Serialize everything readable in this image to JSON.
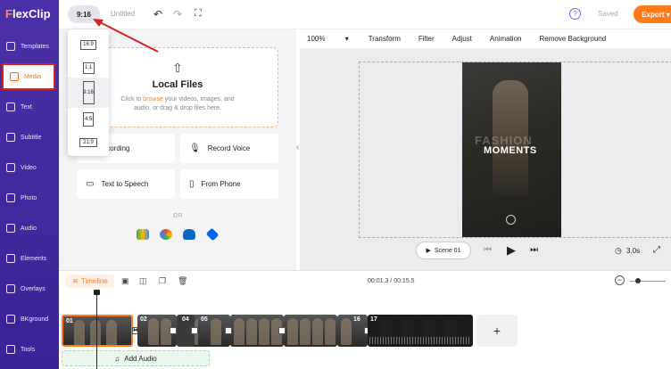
{
  "app": {
    "logo_prefix": "F",
    "logo_rest": "lexClip"
  },
  "sidebar": {
    "items": [
      {
        "label": "Templates",
        "icon": "templates-icon"
      },
      {
        "label": "Media",
        "icon": "media-icon",
        "active": true
      },
      {
        "label": "Text",
        "icon": "text-icon"
      },
      {
        "label": "Subtitle",
        "icon": "subtitle-icon"
      },
      {
        "label": "Video",
        "icon": "video-icon"
      },
      {
        "label": "Photo",
        "icon": "photo-icon"
      },
      {
        "label": "Audio",
        "icon": "audio-icon"
      },
      {
        "label": "Elements",
        "icon": "elements-icon"
      },
      {
        "label": "Overlays",
        "icon": "overlays-icon"
      },
      {
        "label": "BKground",
        "icon": "background-icon"
      },
      {
        "label": "Tools",
        "icon": "tools-icon"
      }
    ]
  },
  "topbar": {
    "ratio": "9:16",
    "title": "Untitled",
    "saved": "Saved",
    "export": "Export"
  },
  "ratio_menu": {
    "options": [
      {
        "label": "16:9"
      },
      {
        "label": "1:1"
      },
      {
        "label": "9:16",
        "selected": true
      },
      {
        "label": "4:5"
      },
      {
        "label": "21:9"
      }
    ]
  },
  "media_panel": {
    "local_title": "Local Files",
    "local_sub_1": "Click to",
    "local_sub_link": "browse",
    "local_sub_2": "your videos, images, and audio, or drag & drop files here.",
    "cards": [
      "Recording",
      "Record Voice",
      "Text to Speech",
      "From Phone"
    ],
    "or": "OR"
  },
  "editbar": {
    "zoom": "100%",
    "tools": [
      "Transform",
      "Filter",
      "Adjust",
      "Animation",
      "Remove Background"
    ]
  },
  "canvas": {
    "text_bg": "FASHION",
    "text_main": "MOMENTS"
  },
  "player": {
    "scene": "Scene 01",
    "duration": "3.0s"
  },
  "timeline": {
    "label": "Timeline",
    "time": "00:01.3 / 00:15.5",
    "clips": [
      "01",
      "02",
      "04",
      "05",
      "16",
      "17"
    ],
    "add_audio": "Add Audio"
  }
}
